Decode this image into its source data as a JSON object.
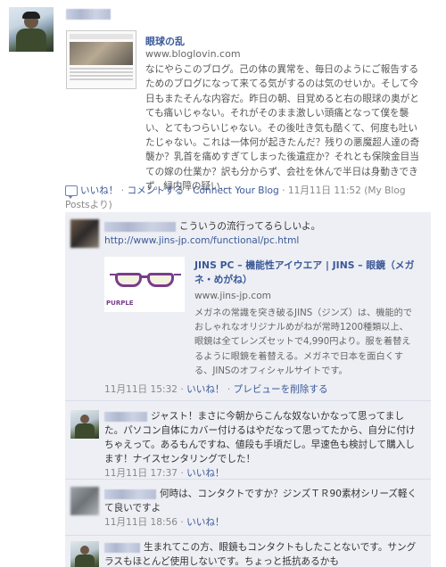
{
  "post": {
    "link_title": "眼球の乱",
    "link_domain": "www.bloglovin.com",
    "link_description": "なにやらこのブログ。己の体の異常を、毎日のようにご報告するためのブログになって来てる気がするのは気のせいか。そして今日もまたそんな内容だ。昨日の朝、目覚めると右の眼球の奥がとても痛いじゃない。それがそのまま激しい頭痛となって僕を襲い、とてもつらいじゃない。その後吐き気も酷くて、何度も吐いたじゃない。これは一体何が起きたんだ？残りの悪魔超人達の奇襲か？乳首を痛めすぎてしまった後遺症か？それとも保険金目当ての嫁の仕業か？訳も分からず、会社を休んで半日は身動きできず。緑内障の疑い...",
    "actions": {
      "like": "いいね！",
      "sep1": " · ",
      "comment": "コメントする",
      "sep2": " · ",
      "connect": "Connect Your Blog",
      "sep3": " · ",
      "timestamp": "11月11日 11:52 (My Blog Postsより)"
    }
  },
  "comments": [
    {
      "text": "こういうの流行ってるらしいよ。",
      "url": "http://www.jins-jp.com/functional/pc.html",
      "share": {
        "thumb_label": "PURPLE",
        "title": "JINS PC – 機能性アイウエア | JINS – 眼鏡（メガネ・めがね）",
        "domain": "www.jins-jp.com",
        "description": "メガネの常識を突き破るJINS（ジンズ）は、機能的でおしゃれなオリジナルめがねが常時1200種類以上、眼鏡は全てレンズセットで4,990円より。服を着替えるように眼鏡を着替える。メガネで日本を面白くする、JINSのオフィシャルサイトです。"
      },
      "time": "11月11日 15:32",
      "like": "いいね！",
      "remove_preview": "プレビューを削除する"
    },
    {
      "text": "ジャスト！まさに今朝からこんな奴ないかなって思ってました。パソコン自体にカバー付けるはやだなって思ってたから、自分に付けちゃえって。あるもんですね、値段も手頃だし。早速色も検討して購入します！ナイスセンタリングでした！",
      "time": "11月11日 17:37",
      "like": "いいね！"
    },
    {
      "text": "何時は、コンタクトですか？ジンズＴＲ90素材シリーズ軽くて良いですよ",
      "time": "11月11日 18:56",
      "like": "いいね！"
    },
    {
      "text": "生まれてこの方、眼鏡もコンタクトもしたことないです。サングラスもほとんど使用しないです。ちょっと抵抗あるかも"
    }
  ],
  "sep": " · "
}
